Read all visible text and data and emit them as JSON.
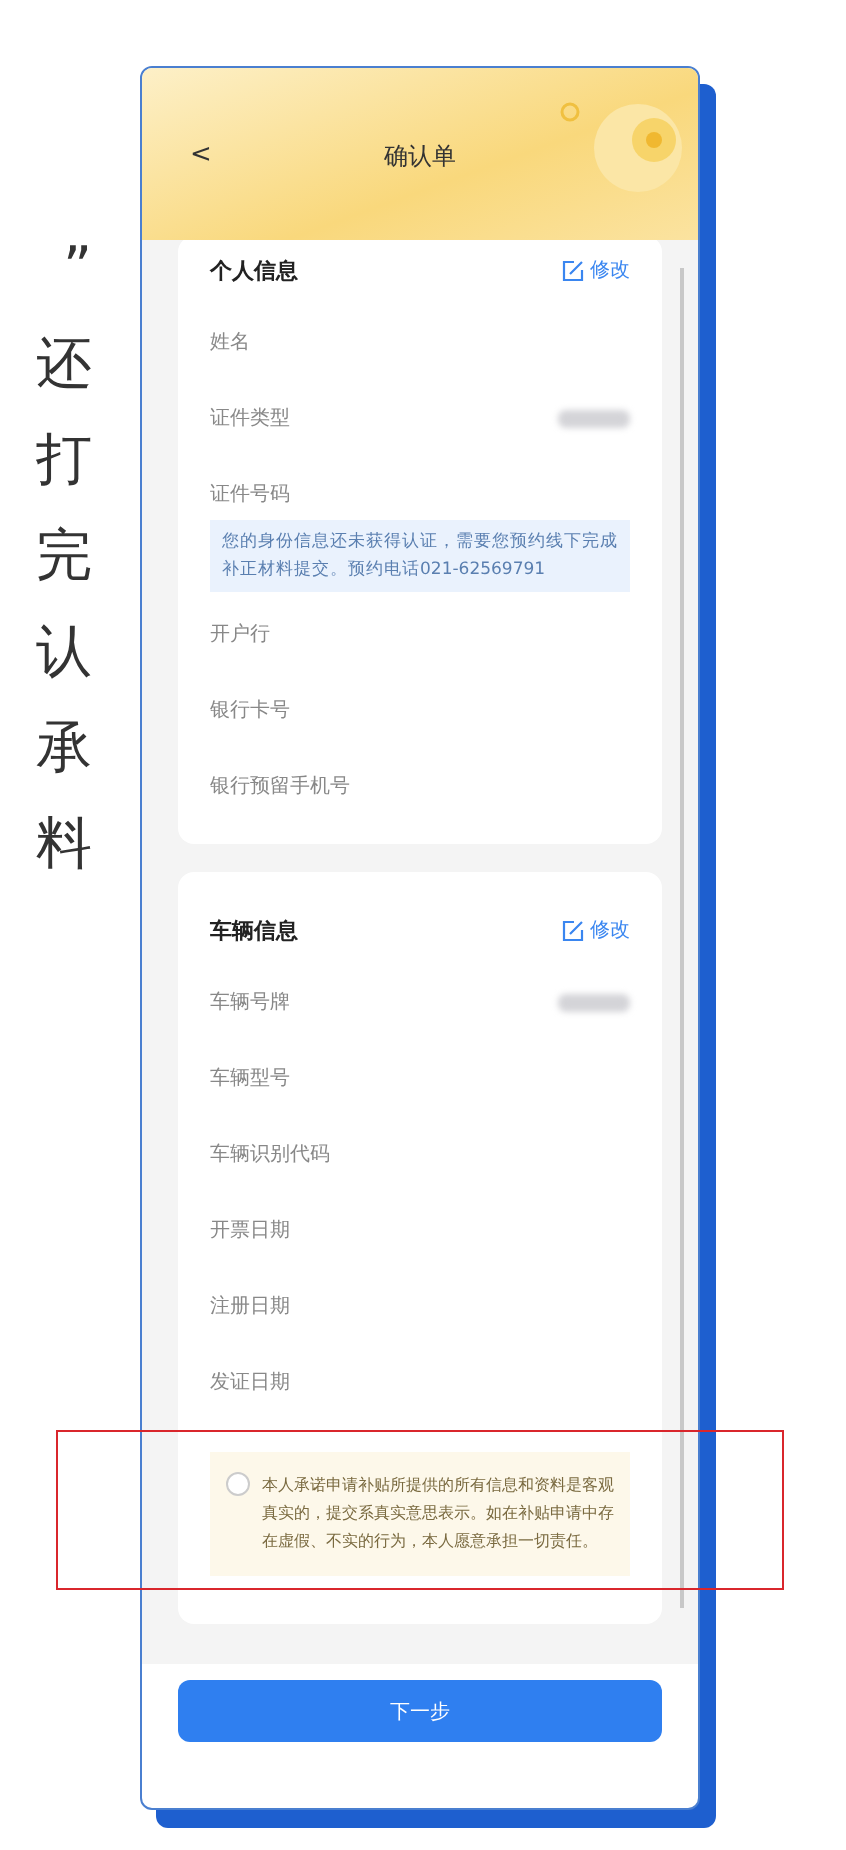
{
  "side_text": [
    "”",
    "还",
    "打",
    "完",
    "认",
    "承",
    "料"
  ],
  "header": {
    "back": "<",
    "title": "确认单"
  },
  "personal": {
    "title": "个人信息",
    "edit": "修改",
    "items": [
      {
        "kind": "field",
        "label": "姓名"
      },
      {
        "kind": "field",
        "label": "证件类型",
        "redacted": true
      },
      {
        "kind": "field",
        "label": "证件号码"
      },
      {
        "kind": "notice",
        "text": "您的身份信息还未获得认证，需要您预约线下完成补正材料提交。预约电话021-62569791"
      },
      {
        "kind": "field",
        "label": "开户行"
      },
      {
        "kind": "field",
        "label": "银行卡号"
      },
      {
        "kind": "field",
        "label": "银行预留手机号"
      }
    ]
  },
  "vehicle": {
    "title": "车辆信息",
    "edit": "修改",
    "items": [
      {
        "kind": "field",
        "label": "车辆号牌",
        "redacted": true
      },
      {
        "kind": "field",
        "label": "车辆型号"
      },
      {
        "kind": "field",
        "label": "车辆识别代码"
      },
      {
        "kind": "field",
        "label": "开票日期"
      },
      {
        "kind": "field",
        "label": "注册日期"
      },
      {
        "kind": "field",
        "label": "发证日期"
      }
    ]
  },
  "agreement": {
    "checked": false,
    "highlighted": true,
    "text": "本人承诺申请补贴所提供的所有信息和资料是客观真实的，提交系真实意思表示。如在补贴申请中存在虚假、不实的行为，本人愿意承担一切责任。"
  },
  "button": "下一步"
}
